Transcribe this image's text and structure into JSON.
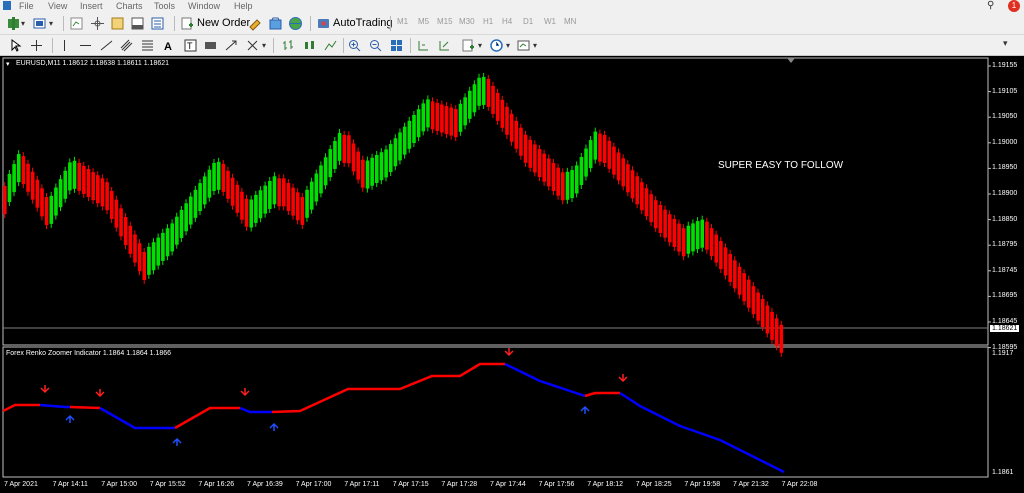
{
  "menu": [
    "File",
    "View",
    "Insert",
    "Charts",
    "Tools",
    "Window",
    "Help"
  ],
  "toolbar": {
    "new_order": "New Order",
    "autotrading": "AutoTrading",
    "timeframes": [
      "M1",
      "M5",
      "M15",
      "M30",
      "H1",
      "H4",
      "D1",
      "W1",
      "MN"
    ],
    "notification_count": "1"
  },
  "main_chart": {
    "header": "EURUSD,M11  1.18612 1.18638 1.18611 1.18621",
    "annotation": "SUPER EASY TO FOLLOW",
    "price_labels": [
      "1.19155",
      "1.19105",
      "1.19050",
      "1.19000",
      "1.18950",
      "1.18900",
      "1.18850",
      "1.18795",
      "1.18745",
      "1.18695",
      "1.18645",
      "1.18595"
    ],
    "current_price": "1.18621",
    "up_color": "#00e000",
    "down_color": "#ff0000"
  },
  "indicator": {
    "header": "Forex Renko Zoomer Indicator 1.1864 1.1864 1.1866",
    "top_label": "1.1917",
    "bottom_label": "1.1861",
    "up_color": "#0000ff",
    "down_color": "#ff0000"
  },
  "time_labels": [
    "7 Apr 2021",
    "7 Apr 14:11",
    "7 Apr 15:00",
    "7 Apr 15:52",
    "7 Apr 16:26",
    "7 Apr 16:39",
    "7 Apr 17:00",
    "7 Apr 17:11",
    "7 Apr 17:15",
    "7 Apr 17:28",
    "7 Apr 17:44",
    "7 Apr 17:56",
    "7 Apr 18:12",
    "7 Apr 18:25",
    "7 Apr 19:58",
    "7 Apr 21:32",
    "7 Apr 22:08"
  ]
}
